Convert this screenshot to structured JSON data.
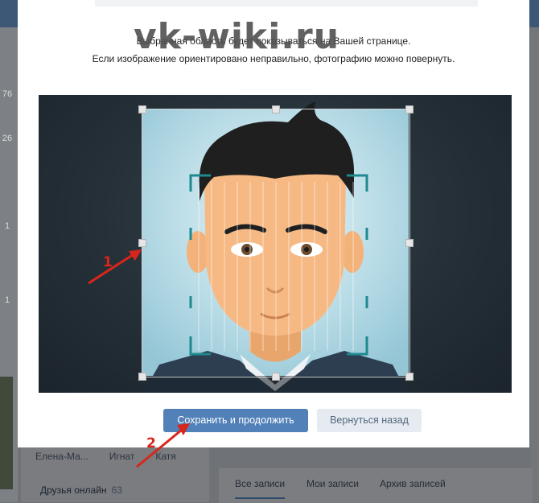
{
  "watermark": "vk-wiki.ru",
  "modal": {
    "description_line1": "Выбранная область будет показываться на Вашей странице.",
    "description_line2": "Если изображение ориентировано неправильно, фотографию можно повернуть.",
    "save_button": "Сохранить и продолжить",
    "back_button": "Вернуться назад"
  },
  "markers": {
    "first": "1",
    "second": "2"
  },
  "background": {
    "left_counts": [
      "76",
      "26",
      "1",
      "1"
    ],
    "friends": [
      "Елена-Ма...",
      "Игнат",
      "Катя"
    ],
    "online_label": "Друзья онлайн",
    "online_count": "63",
    "wall_tabs": [
      "Все записи",
      "Мои записи",
      "Архив записей"
    ]
  },
  "colors": {
    "primary_button": "#5181b8",
    "secondary_button": "#e5ebf1",
    "annotation_red": "#d9261c"
  },
  "icons": {
    "arrow": "red-arrow-icon",
    "avatar": "avatar-illustration-icon"
  }
}
